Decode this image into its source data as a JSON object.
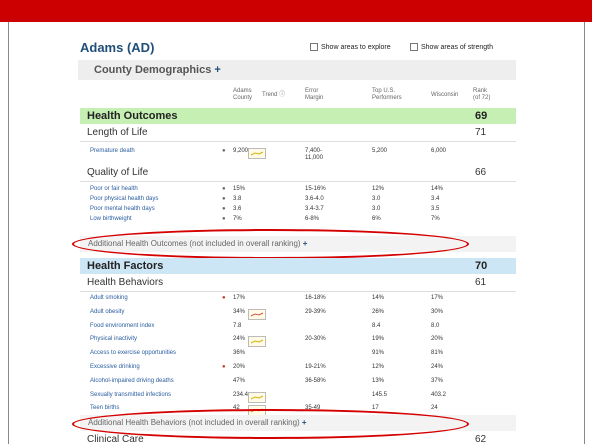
{
  "county_title": "Adams (AD)",
  "options": {
    "explore_label": "Show areas to explore",
    "strength_label": "Show areas of strength"
  },
  "demographics": {
    "label": "County Demographics",
    "plus": "+"
  },
  "columns": {
    "county": "Adams\nCounty",
    "trend": "Trend",
    "error": "Error\nMargin",
    "top": "Top U.S.\nPerformers",
    "state": "Wisconsin",
    "rank": "Rank\n(of 72)"
  },
  "health_outcomes": {
    "label": "Health Outcomes",
    "rank": "69"
  },
  "length_of_life": {
    "label": "Length of Life",
    "rank": "71"
  },
  "length_rows": [
    {
      "name": "Premature death",
      "value": "9,200",
      "error": "7,400-\n11,000",
      "top": "5,200",
      "state": "6,000",
      "trend": "yellow"
    }
  ],
  "quality_of_life": {
    "label": "Quality of Life",
    "rank": "66"
  },
  "quality_rows": [
    {
      "name": "Poor or fair health",
      "value": "15%",
      "error": "15-16%",
      "top": "12%",
      "state": "14%"
    },
    {
      "name": "Poor physical health days",
      "value": "3.8",
      "error": "3.6-4.0",
      "top": "3.0",
      "state": "3.4"
    },
    {
      "name": "Poor mental health days",
      "value": "3.6",
      "error": "3.4-3.7",
      "top": "3.0",
      "state": "3.5"
    },
    {
      "name": "Low birthweight",
      "value": "7%",
      "error": "6-8%",
      "top": "6%",
      "state": "7%"
    }
  ],
  "additional_outcomes": {
    "label": "Additional Health Outcomes (not included in overall ranking)",
    "plus": "+"
  },
  "health_factors": {
    "label": "Health Factors",
    "rank": "70"
  },
  "health_behaviors": {
    "label": "Health Behaviors",
    "rank": "61"
  },
  "behavior_rows": [
    {
      "name": "Adult smoking",
      "value": "17%",
      "error": "16-18%",
      "top": "14%",
      "state": "17%",
      "info": true
    },
    {
      "name": "Adult obesity",
      "value": "34%",
      "error": "29-39%",
      "top": "26%",
      "state": "30%",
      "trend": "red"
    },
    {
      "name": "Food environment index",
      "value": "7.8",
      "error": "",
      "top": "8.4",
      "state": "8.0"
    },
    {
      "name": "Physical inactivity",
      "value": "24%",
      "error": "20-30%",
      "top": "19%",
      "state": "20%",
      "trend": "yellow"
    },
    {
      "name": "Access to exercise opportunities",
      "value": "36%",
      "error": "",
      "top": "91%",
      "state": "81%"
    },
    {
      "name": "Excessive drinking",
      "value": "20%",
      "error": "19-21%",
      "top": "12%",
      "state": "24%",
      "info": true
    },
    {
      "name": "Alcohol-impaired driving deaths",
      "value": "47%",
      "error": "36-58%",
      "top": "13%",
      "state": "37%"
    },
    {
      "name": "Sexually transmitted infections",
      "value": "234.4",
      "error": "",
      "top": "145.5",
      "state": "403.2",
      "trend": "yellow"
    },
    {
      "name": "Teen births",
      "value": "42",
      "error": "35-49",
      "top": "17",
      "state": "24",
      "trend": "yellow"
    }
  ],
  "additional_behaviors": {
    "label": "Additional Health Behaviors (not included in overall ranking)",
    "plus": "+"
  },
  "clinical_care": {
    "label": "Clinical Care",
    "rank": "62"
  },
  "colors": {
    "topbar": "#cc0000",
    "outcomes_band": "#c6efb4",
    "factors_band": "#cde6f5",
    "annotation": "#d40000"
  }
}
